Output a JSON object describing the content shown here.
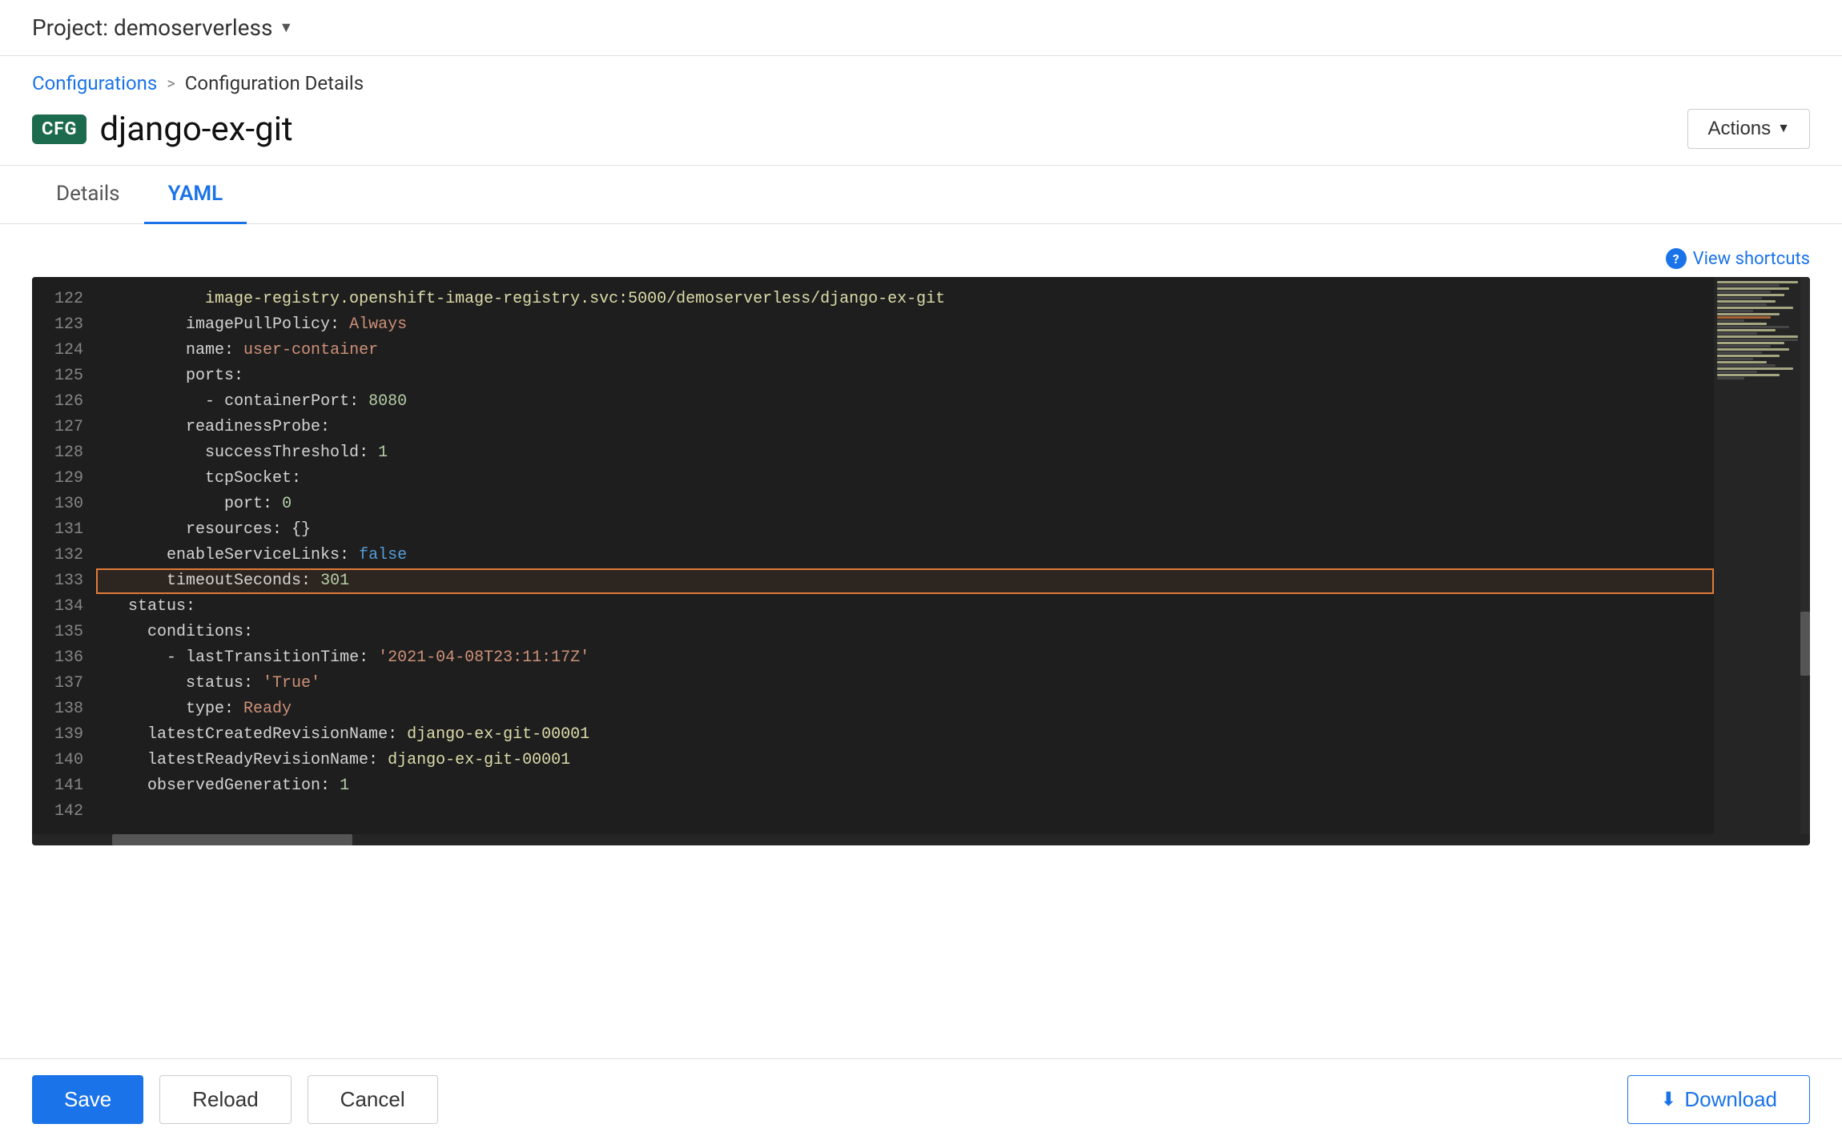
{
  "topbar": {
    "project_label": "Project: demoserverless"
  },
  "breadcrumb": {
    "link_label": "Configurations",
    "separator": ">",
    "current": "Configuration Details"
  },
  "page_title": {
    "badge": "CFG",
    "name": "django-ex-git",
    "actions_label": "Actions"
  },
  "tabs": [
    {
      "label": "Details",
      "active": false
    },
    {
      "label": "YAML",
      "active": true
    }
  ],
  "editor": {
    "view_shortcuts": "View shortcuts",
    "lines": [
      {
        "num": "122",
        "content": "          image-registry.openshift-image-registry.svc:5000/demoserverless/django-ex-git",
        "highlight": false
      },
      {
        "num": "123",
        "content": "        imagePullPolicy: Always",
        "highlight": false
      },
      {
        "num": "124",
        "content": "        name: user-container",
        "highlight": false
      },
      {
        "num": "125",
        "content": "        ports:",
        "highlight": false
      },
      {
        "num": "126",
        "content": "          - containerPort: 8080",
        "highlight": false
      },
      {
        "num": "127",
        "content": "        readinessProbe:",
        "highlight": false
      },
      {
        "num": "128",
        "content": "          successThreshold: 1",
        "highlight": false
      },
      {
        "num": "129",
        "content": "          tcpSocket:",
        "highlight": false
      },
      {
        "num": "130",
        "content": "            port: 0",
        "highlight": false
      },
      {
        "num": "131",
        "content": "        resources: {}",
        "highlight": false
      },
      {
        "num": "132",
        "content": "      enableServiceLinks: false",
        "highlight": false
      },
      {
        "num": "133",
        "content": "      timeoutSeconds: 301",
        "highlight": true
      },
      {
        "num": "134",
        "content": "  status:",
        "highlight": false
      },
      {
        "num": "135",
        "content": "    conditions:",
        "highlight": false
      },
      {
        "num": "136",
        "content": "      - lastTransitionTime: '2021-04-08T23:11:17Z'",
        "highlight": false
      },
      {
        "num": "137",
        "content": "        status: 'True'",
        "highlight": false
      },
      {
        "num": "138",
        "content": "        type: Ready",
        "highlight": false
      },
      {
        "num": "139",
        "content": "    latestCreatedRevisionName: django-ex-git-00001",
        "highlight": false
      },
      {
        "num": "140",
        "content": "    latestReadyRevisionName: django-ex-git-00001",
        "highlight": false
      },
      {
        "num": "141",
        "content": "    observedGeneration: 1",
        "highlight": false
      },
      {
        "num": "142",
        "content": "",
        "highlight": false
      }
    ]
  },
  "bottom_toolbar": {
    "save_label": "Save",
    "reload_label": "Reload",
    "cancel_label": "Cancel",
    "download_label": "Download"
  }
}
